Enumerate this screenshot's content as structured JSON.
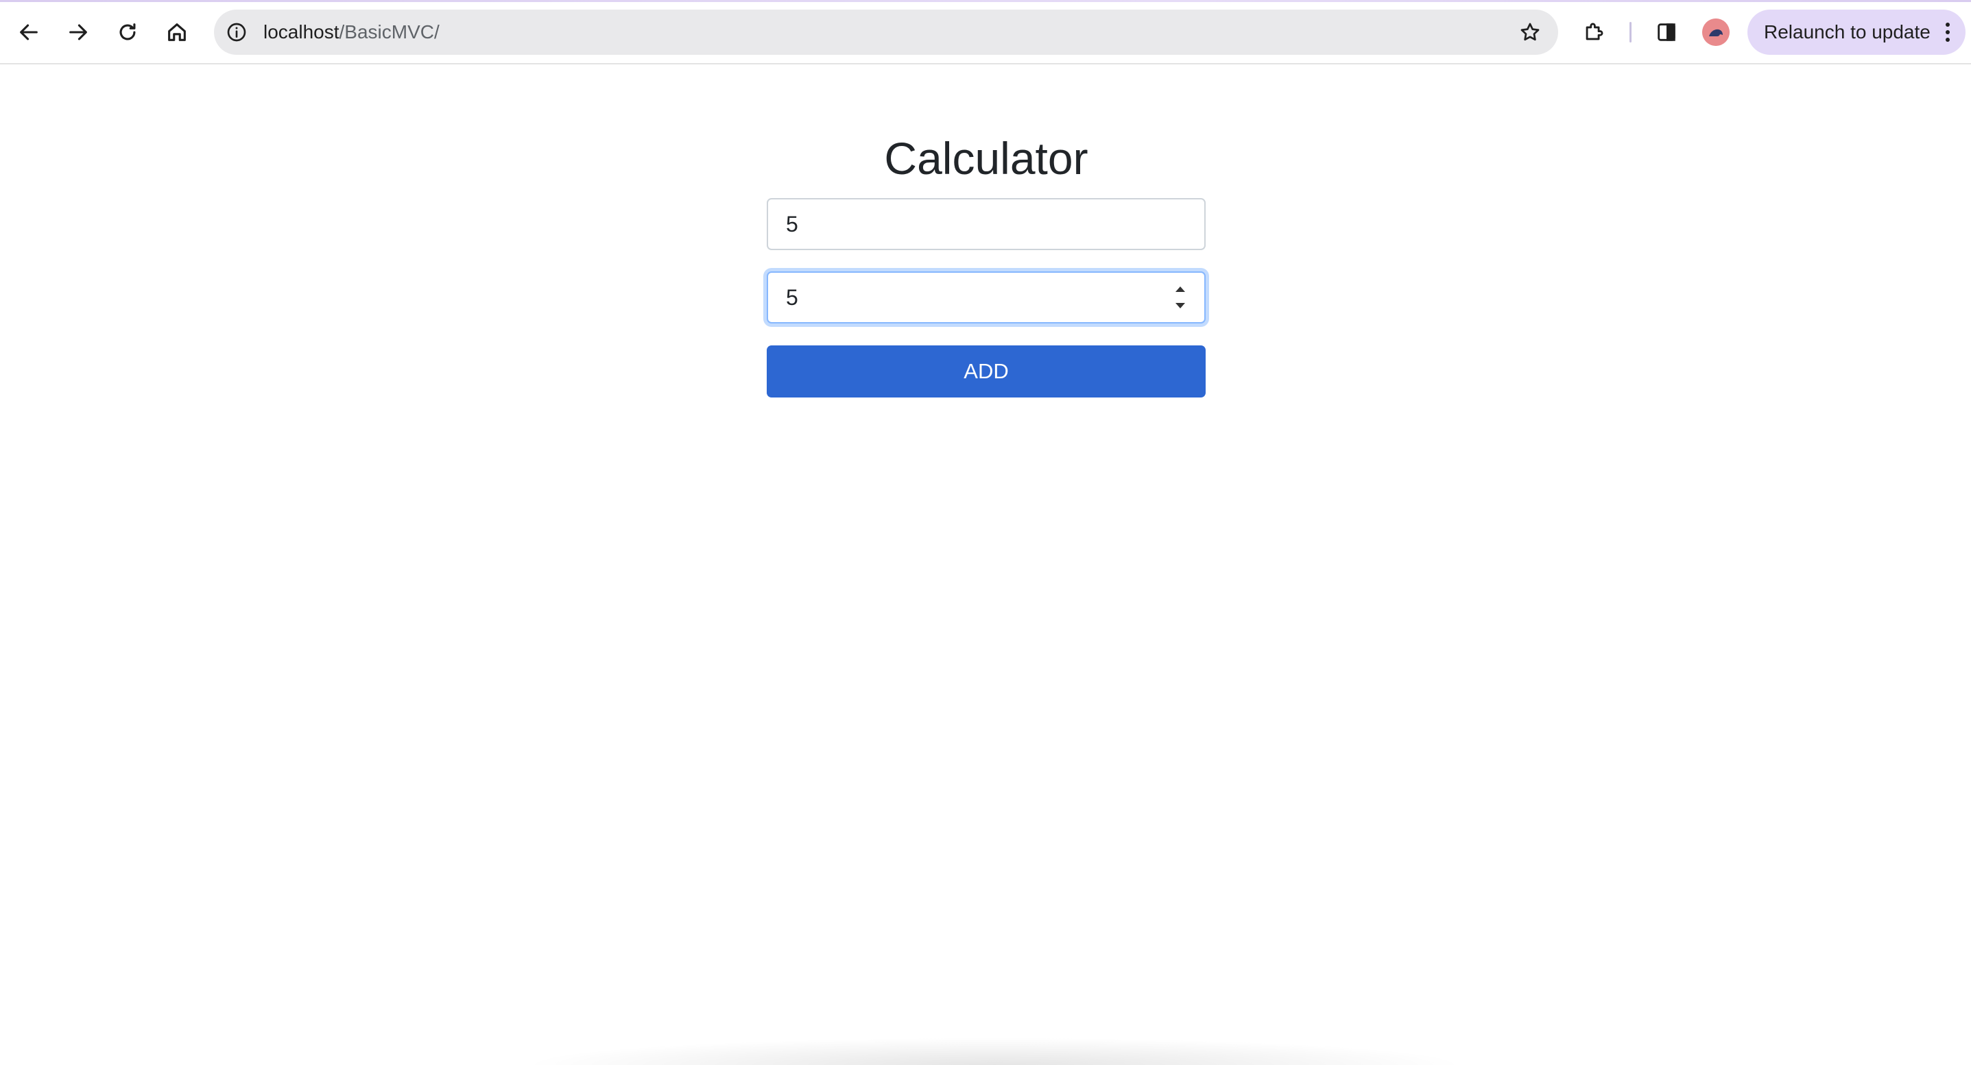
{
  "browser": {
    "url_host": "localhost",
    "url_path": "/BasicMVC/",
    "relaunch_label": "Relaunch to update",
    "icons": {
      "back": "arrow-left-icon",
      "forward": "arrow-right-icon",
      "reload": "reload-icon",
      "home": "home-icon",
      "site_info": "info-icon",
      "bookmark": "star-icon",
      "extensions": "puzzle-icon",
      "side_panel": "side-panel-icon",
      "menu": "kebab-menu-icon"
    },
    "accent_color": "#e3d9f8"
  },
  "page": {
    "title": "Calculator",
    "first_number": "5",
    "second_number": "5",
    "add_label": "ADD",
    "button_color": "#2d67d2"
  }
}
